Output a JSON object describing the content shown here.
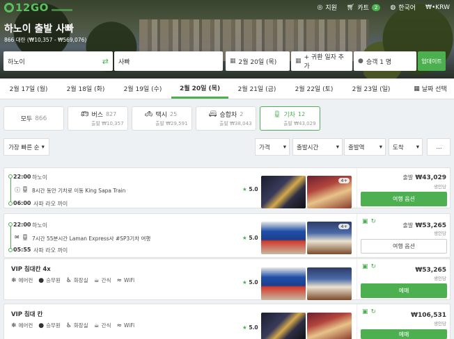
{
  "brand": {
    "logo": "12GO"
  },
  "topnav": {
    "support": "지원",
    "cart": "카트",
    "cart_count": "2",
    "language": "한국어",
    "currency": "₩•KRW"
  },
  "route": {
    "title": "하노이 출발 사빠",
    "subtitle": "866 대란 (₩10,357 - ₩569,076)"
  },
  "search": {
    "from": "하노이",
    "to": "사빠",
    "date": "2월 20일 (목)",
    "return": "+ 귀환 일자 추가",
    "passengers": "승객 1 명",
    "update": "업데이트"
  },
  "dates": [
    "2월 17일 (월)",
    "2월 18일 (화)",
    "2월 19일 (수)",
    "2월 20일 (목)",
    "2월 21일 (금)",
    "2월 22일 (토)",
    "2월 23일 (일)"
  ],
  "date_picker": "날짜 선택",
  "tabs": {
    "all": {
      "label": "모두",
      "count": "866"
    },
    "bus": {
      "label": "버스",
      "count": "827",
      "price": "출발 ₩10,357"
    },
    "taxi": {
      "label": "택시",
      "count": "25",
      "price": "출발 ₩29,591"
    },
    "van": {
      "label": "승합차",
      "count": "2",
      "price": "출발 ₩38,043"
    },
    "train": {
      "label": "기차",
      "count": "12",
      "price": "출발 ₩43,029"
    }
  },
  "filters": {
    "sort": "가장 빠른 순",
    "price": "가격",
    "departure_time": "출발시간",
    "departure_station": "출발역",
    "arrival": "도착",
    "more": "..."
  },
  "cards": [
    {
      "dep_time": "22:00",
      "dep_place": "하노이",
      "duration": "8시간 동안 기차로 이동 King Sapa Train",
      "arr_time": "06:00",
      "arr_place": "사파 라오 까이",
      "rating": "5.0",
      "more_photos": "4+",
      "price_prefix": "출발",
      "price": "₩43,029",
      "price_note": "생인당",
      "button": "여행 옵션"
    },
    {
      "dep_time": "22:00",
      "dep_place": "하노이",
      "duration": "7시간 55분시간 Laman Express사 #SP3기차 여행",
      "arr_time": "05:55",
      "arr_place": "사파 라오 까이",
      "rating": "5.0",
      "more_photos": "4+",
      "price_prefix": "출발",
      "price": "₩53,265",
      "price_note": "생인당",
      "button": "여행 옵션"
    }
  ],
  "vip_cards": [
    {
      "title": "VIP 침대칸 4x",
      "amenities": [
        "에어컨",
        "승무원",
        "화장실",
        "간식",
        "WiFi"
      ],
      "rating": "5.0",
      "price": "₩53,265",
      "price_note": "생인당",
      "button": "예매"
    },
    {
      "title": "VIP 침대 칸",
      "amenities": [
        "에어컨",
        "승무원",
        "화장실",
        "간식",
        "WiFi"
      ],
      "rating": "5.0",
      "price": "₩106,531",
      "price_note": "생인당",
      "button": "예매"
    }
  ]
}
